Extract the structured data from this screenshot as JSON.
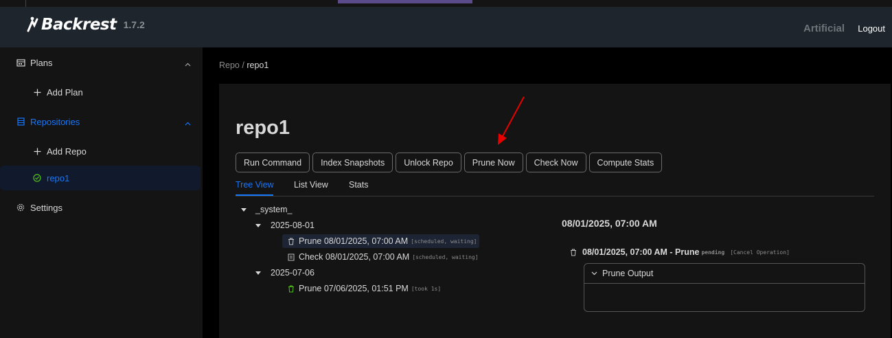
{
  "app": {
    "brand": "Backrest",
    "version": "1.7.2",
    "user": "Artificial",
    "logout_label": "Logout"
  },
  "sidebar": {
    "items": [
      {
        "label": "Plans",
        "icon": "calendar-icon"
      },
      {
        "label": "Add Plan",
        "icon": "plus-icon"
      },
      {
        "label": "Repositories",
        "icon": "database-icon"
      },
      {
        "label": "Add Repo",
        "icon": "plus-icon"
      },
      {
        "label": "repo1",
        "icon": "check-circle-icon"
      },
      {
        "label": "Settings",
        "icon": "gear-icon"
      }
    ]
  },
  "breadcrumb": {
    "parent": "Repo",
    "separator": "/",
    "current": "repo1"
  },
  "repo": {
    "title": "repo1",
    "actions": [
      "Run Command",
      "Index Snapshots",
      "Unlock Repo",
      "Prune Now",
      "Check Now",
      "Compute Stats"
    ]
  },
  "tabs": [
    "Tree View",
    "List View",
    "Stats"
  ],
  "tree": {
    "root": "_system_",
    "groups": [
      {
        "date": "2025-08-01",
        "ops": [
          {
            "label": "Prune 08/01/2025, 07:00 AM",
            "status": "[scheduled, waiting]",
            "icon": "trash-icon"
          },
          {
            "label": "Check 08/01/2025, 07:00 AM",
            "status": "[scheduled, waiting]",
            "icon": "file-check-icon"
          }
        ]
      },
      {
        "date": "2025-07-06",
        "ops": [
          {
            "label": "Prune 07/06/2025, 01:51 PM",
            "status": "[took 1s]",
            "icon": "trash-icon"
          }
        ]
      }
    ]
  },
  "detail": {
    "date": "08/01/2025, 07:00 AM",
    "op_title": "08/01/2025, 07:00 AM - Prune",
    "op_state": "pending",
    "cancel_label": "[Cancel Operation]",
    "output_label": "Prune Output"
  },
  "colors": {
    "accent": "#1677ff",
    "success": "#52c41a",
    "arrow": "#e60000"
  }
}
